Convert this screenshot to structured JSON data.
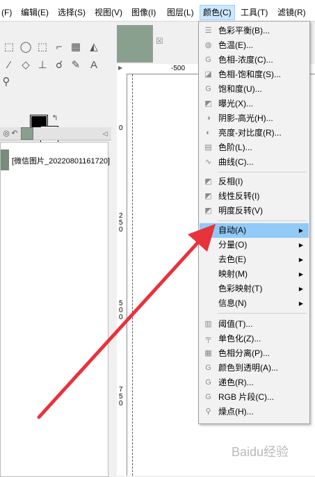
{
  "menubar": {
    "items": [
      "(F)",
      "编辑(E)",
      "选择(S)",
      "视图(V)",
      "图像(I)",
      "图层(L)",
      "颜色(C)",
      "工具(T)",
      "滤镜(R)"
    ]
  },
  "layers": {
    "layer_name": "[微信图片_20220801161720]"
  },
  "ruler": {
    "h_label": "-500",
    "v_labels": [
      "0",
      "250",
      "500",
      "750"
    ]
  },
  "colors_menu": {
    "items": [
      {
        "label": "色彩平衡(B)...",
        "icon": "color-balance-icon",
        "submenu": false
      },
      {
        "label": "色温(E)...",
        "icon": "color-temperature-icon",
        "submenu": false
      },
      {
        "label": "色相-浓度(C)...",
        "icon": "hue-chroma-icon",
        "submenu": false
      },
      {
        "label": "色相-饱和度(S)...",
        "icon": "hue-saturation-icon",
        "submenu": false
      },
      {
        "label": "饱和度(U)...",
        "icon": "saturation-icon",
        "submenu": false
      },
      {
        "label": "曝光(X)...",
        "icon": "exposure-icon",
        "submenu": false
      },
      {
        "label": "阴影-高光(H)...",
        "icon": "shadows-highlights-icon",
        "submenu": false
      },
      {
        "label": "亮度-对比度(R)...",
        "icon": "brightness-contrast-icon",
        "submenu": false
      },
      {
        "label": "色阶(L)...",
        "icon": "levels-icon",
        "submenu": false
      },
      {
        "label": "曲线(C)...",
        "icon": "curves-icon",
        "submenu": false
      },
      {
        "label": "反相(I)",
        "icon": "invert-icon",
        "submenu": false
      },
      {
        "label": "线性反转(I)",
        "icon": "linear-invert-icon",
        "submenu": false
      },
      {
        "label": "明度反转(V)",
        "icon": "value-invert-icon",
        "submenu": false
      },
      {
        "label": "自动(A)",
        "icon": "",
        "submenu": true
      },
      {
        "label": "分量(O)",
        "icon": "",
        "submenu": true
      },
      {
        "label": "去色(E)",
        "icon": "",
        "submenu": true
      },
      {
        "label": "映射(M)",
        "icon": "",
        "submenu": true
      },
      {
        "label": "色彩映射(T)",
        "icon": "",
        "submenu": true
      },
      {
        "label": "信息(N)",
        "icon": "",
        "submenu": true
      },
      {
        "label": "阈值(T)...",
        "icon": "threshold-icon",
        "submenu": false
      },
      {
        "label": "单色化(Z)...",
        "icon": "colorize-icon",
        "submenu": false
      },
      {
        "label": "色相分离(P)...",
        "icon": "posterize-icon",
        "submenu": false
      },
      {
        "label": "颜色到透明(A)...",
        "icon": "color-to-alpha-icon",
        "submenu": false
      },
      {
        "label": "递色(R)...",
        "icon": "dither-icon",
        "submenu": false
      },
      {
        "label": "RGB 片段(C)...",
        "icon": "rgb-clip-icon",
        "submenu": false
      },
      {
        "label": "燥点(H)...",
        "icon": "hot-spots-icon",
        "submenu": false
      }
    ],
    "highlighted": "自动(A)"
  },
  "colors": {
    "menu_highlight": "#91c9f7",
    "active_menu_bg": "#cce8ff",
    "annotation_arrow": "#e8323c"
  },
  "watermark": "Baidu经验"
}
